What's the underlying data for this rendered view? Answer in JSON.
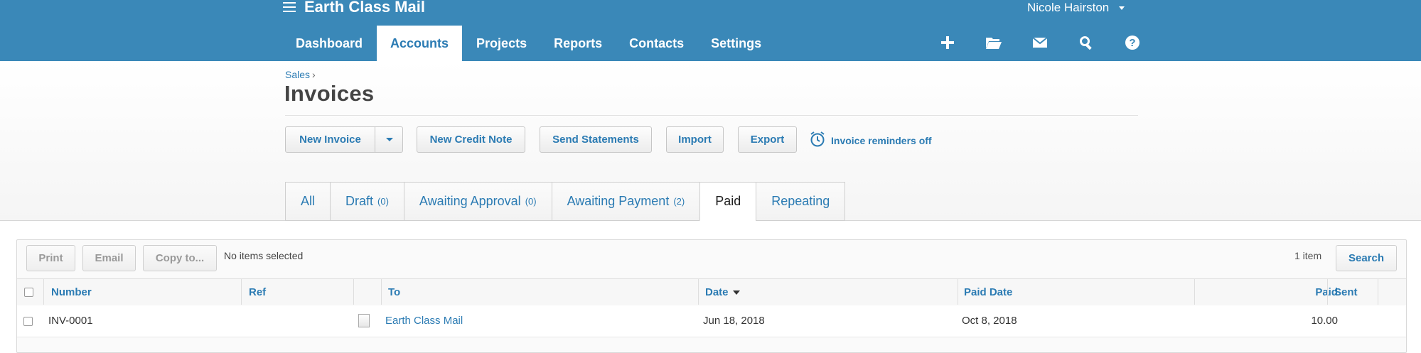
{
  "header": {
    "org_name": "Earth Class Mail",
    "user_name": "Nicole Hairston",
    "nav": [
      {
        "label": "Dashboard"
      },
      {
        "label": "Accounts"
      },
      {
        "label": "Projects"
      },
      {
        "label": "Reports"
      },
      {
        "label": "Contacts"
      },
      {
        "label": "Settings"
      }
    ],
    "active_nav": "Accounts",
    "tools": [
      "plus-icon",
      "folder-icon",
      "mail-icon",
      "search-icon",
      "help-icon"
    ]
  },
  "page": {
    "breadcrumb": "Sales",
    "breadcrumb_sep": "›",
    "title": "Invoices"
  },
  "toolbar": {
    "new_invoice": "New Invoice",
    "new_credit_note": "New Credit Note",
    "send_statements": "Send Statements",
    "import": "Import",
    "export": "Export",
    "reminders": "Invoice reminders off"
  },
  "status_tabs": [
    {
      "label": "All",
      "count": ""
    },
    {
      "label": "Draft",
      "count": "(0)"
    },
    {
      "label": "Awaiting Approval",
      "count": "(0)"
    },
    {
      "label": "Awaiting Payment",
      "count": "(2)"
    },
    {
      "label": "Paid",
      "count": ""
    },
    {
      "label": "Repeating",
      "count": ""
    }
  ],
  "active_status_tab": "Paid",
  "list": {
    "actions": {
      "print": "Print",
      "email": "Email",
      "copy_to": "Copy to..."
    },
    "selection_text": "No items selected",
    "item_count": "1 item",
    "search": "Search",
    "columns": {
      "number": "Number",
      "ref": "Ref",
      "to": "To",
      "date": "Date",
      "paid_date": "Paid Date",
      "paid": "Paid",
      "sent": "Sent"
    },
    "sorted_column": "date",
    "rows": [
      {
        "number": "INV-0001",
        "ref": "",
        "to": "Earth Class Mail",
        "date": "Jun 18, 2018",
        "paid_date": "Oct 8, 2018",
        "paid": "10.00",
        "sent": ""
      }
    ]
  },
  "colors": {
    "header_bg": "#3a88b8",
    "link": "#2b7bb3"
  }
}
